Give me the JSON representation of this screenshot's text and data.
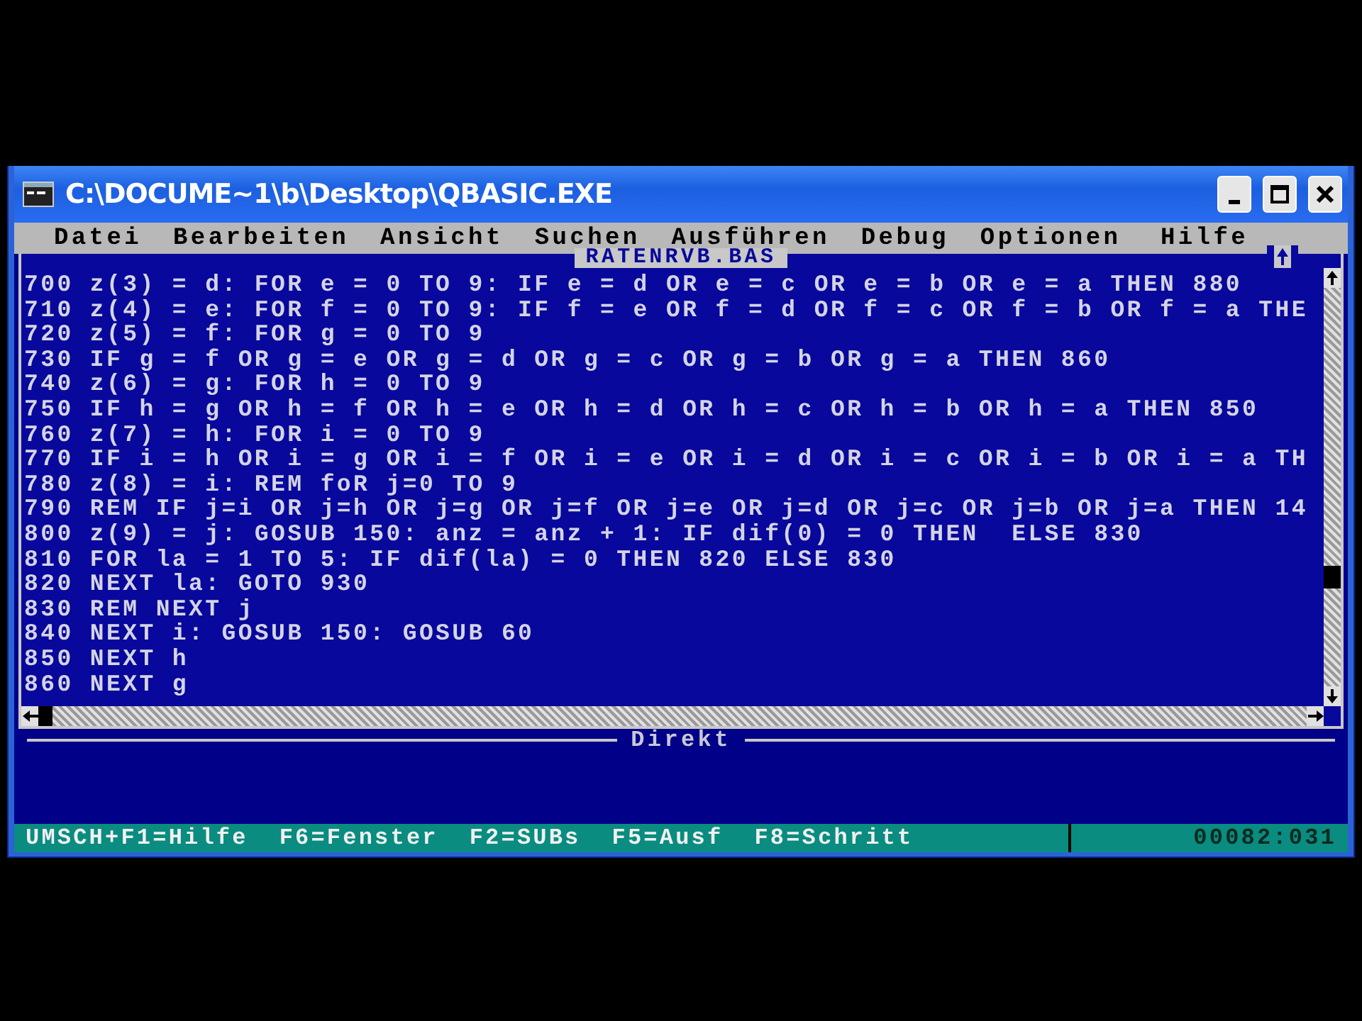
{
  "window": {
    "title": "C:\\DOCUME~1\\b\\Desktop\\QBASIC.EXE"
  },
  "menu": [
    "Datei",
    "Bearbeiten",
    "Ansicht",
    "Suchen",
    "Ausführen",
    "Debug",
    "Optionen",
    "Hilfe"
  ],
  "editor": {
    "title": "RATENRVB.BAS",
    "lines": [
      "700 z(3) = d: FOR e = 0 TO 9: IF e = d OR e = c OR e = b OR e = a THEN 880",
      "710 z(4) = e: FOR f = 0 TO 9: IF f = e OR f = d OR f = c OR f = b OR f = a THE",
      "720 z(5) = f: FOR g = 0 TO 9",
      "730 IF g = f OR g = e OR g = d OR g = c OR g = b OR g = a THEN 860",
      "740 z(6) = g: FOR h = 0 TO 9",
      "750 IF h = g OR h = f OR h = e OR h = d OR h = c OR h = b OR h = a THEN 850",
      "760 z(7) = h: FOR i = 0 TO 9",
      "770 IF i = h OR i = g OR i = f OR i = e OR i = d OR i = c OR i = b OR i = a TH",
      "780 z(8) = i: REM foR j=0 TO 9",
      "790 REM IF j=i OR j=h OR j=g OR j=f OR j=e OR j=d OR j=c OR j=b OR j=a THEN 14",
      "800 z(9) = j: GOSUB 150: anz = anz + 1: IF dif(0) = 0 THEN  ELSE 830",
      "810 FOR la = 1 TO 5: IF dif(la) = 0 THEN 820 ELSE 830",
      "820 NEXT la: GOTO 930",
      "830 REM NEXT j",
      "840 NEXT i: GOSUB 150: GOSUB 60",
      "850 NEXT h",
      "860 NEXT g"
    ]
  },
  "immediate": {
    "title": "Direkt"
  },
  "status_bar": {
    "items": [
      "UMSCH+F1=Hilfe",
      "F6=Fenster",
      "F2=SUBs",
      "F5=Ausf",
      "F8=Schritt"
    ],
    "position": "00082:031"
  }
}
